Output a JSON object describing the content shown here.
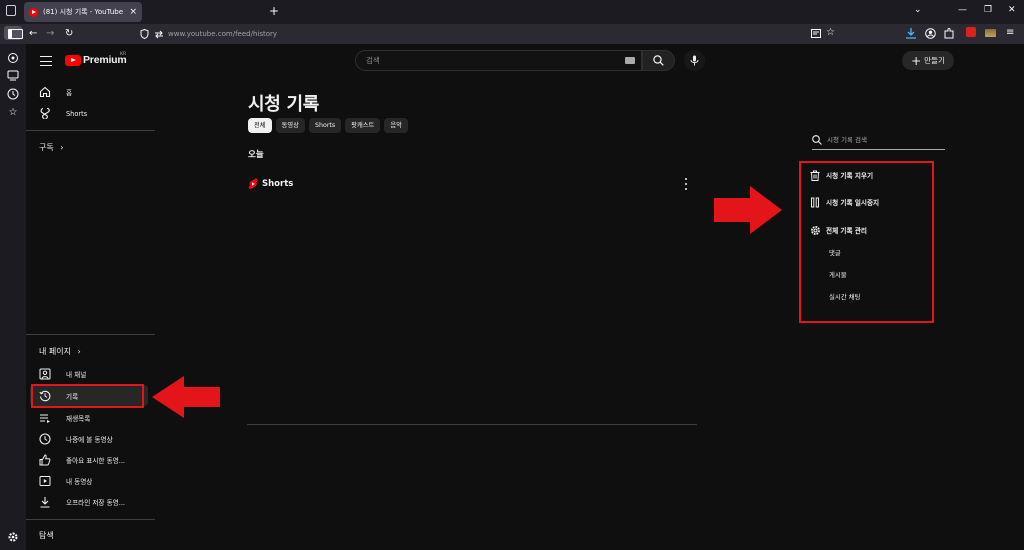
{
  "browser": {
    "tab_title": "(81) 시청 기록 - YouTube",
    "tab_close": "×",
    "new_tab": "+",
    "url": "www.youtube.com/feed/history",
    "back": "←",
    "forward": "→",
    "reload": "↻",
    "window_minimize": "—",
    "window_maximize": "❐",
    "window_close": "✕",
    "tab_list": "⌄",
    "menu": "≡"
  },
  "youtube": {
    "logo_text": "Premium",
    "logo_region": "KR",
    "search_placeholder": "검색",
    "create_label": "만들기",
    "create_plus": "+"
  },
  "guide": {
    "top_items": [
      {
        "label": "홈",
        "icon": "home-icon"
      },
      {
        "label": "Shorts",
        "icon": "shorts-icon"
      }
    ],
    "subscriptions_label": "구독",
    "you_label": "내 페이지",
    "you_items": [
      {
        "label": "내 채널",
        "icon": "channel-icon"
      },
      {
        "label": "기록",
        "icon": "history-icon",
        "active": true
      },
      {
        "label": "재생목록",
        "icon": "playlist-icon"
      },
      {
        "label": "나중에 볼 동영상",
        "icon": "watch-later-icon"
      },
      {
        "label": "좋아요 표시한 동영...",
        "icon": "like-icon"
      },
      {
        "label": "내 동영상",
        "icon": "your-videos-icon"
      },
      {
        "label": "오프라인 저장 동영...",
        "icon": "download-icon"
      }
    ],
    "explore_label": "탐색",
    "chevron": "›"
  },
  "main": {
    "title": "시청 기록",
    "chips": [
      {
        "label": "전체",
        "active": true
      },
      {
        "label": "동영상"
      },
      {
        "label": "Shorts"
      },
      {
        "label": "팟캐스트"
      },
      {
        "label": "음악"
      }
    ],
    "section_date": "오늘",
    "shorts_label": "Shorts"
  },
  "history_panel": {
    "search_placeholder": "시청 기록 검색",
    "clear_label": "시청 기록 지우기",
    "pause_label": "시청 기록 일시중지",
    "manage_label": "전체 기록 관리",
    "sub_items": [
      "댓글",
      "게시물",
      "실시간 채팅"
    ]
  },
  "colors": {
    "accent_red": "#ff0000",
    "annotation_red": "#e4141b",
    "background": "#0f0f0f"
  }
}
